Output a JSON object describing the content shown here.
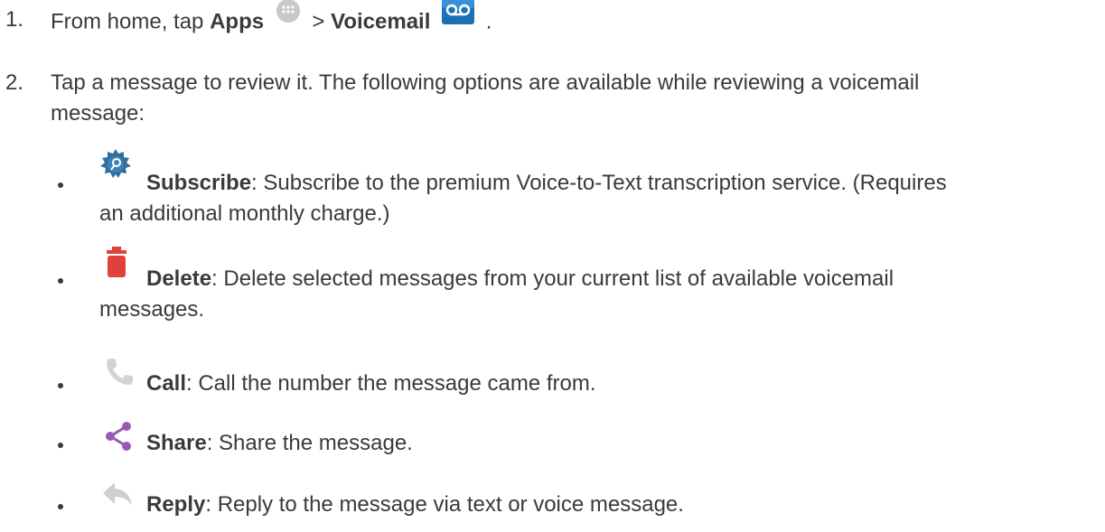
{
  "step1": {
    "number": "1.",
    "prefix": "From home, tap",
    "apps_label": "Apps",
    "separator": ">",
    "voicemail_label": "Voicemail",
    "suffix": ".",
    "icons": [
      "apps-grid-icon",
      "voicemail-icon"
    ]
  },
  "step2": {
    "number": "2.",
    "text_line1": "Tap a message to review it. The following options are available while reviewing a voicemail",
    "text_line2": "message:"
  },
  "options": [
    {
      "icon": "subscribe-badge-icon",
      "label": "Subscribe",
      "description_line1": ": Subscribe to the premium Voice-to-Text transcription service. (Requires",
      "description_line2": "an additional monthly charge.)"
    },
    {
      "icon": "trash-icon",
      "label": "Delete",
      "description_line1": ": Delete selected messages from your current list of available voicemail",
      "description_line2": "messages."
    },
    {
      "icon": "phone-icon",
      "label": "Call",
      "description_line1": ": Call the number the message came from.",
      "description_line2": ""
    },
    {
      "icon": "share-icon",
      "label": "Share",
      "description_line1": ": Share the message.",
      "description_line2": ""
    },
    {
      "icon": "reply-icon",
      "label": "Reply",
      "description_line1": ": Reply to the message via text or voice message.",
      "description_line2": ""
    }
  ],
  "colors": {
    "text": "#3a3a3a",
    "apps_icon": "#c8c8c8",
    "voicemail_icon": "#1f6fb5",
    "subscribe_icon": "#2e6fa0",
    "delete_icon": "#e0413a",
    "call_icon": "#d3d3d3",
    "share_icon": "#9b59b6",
    "reply_icon": "#cfcfcf"
  }
}
